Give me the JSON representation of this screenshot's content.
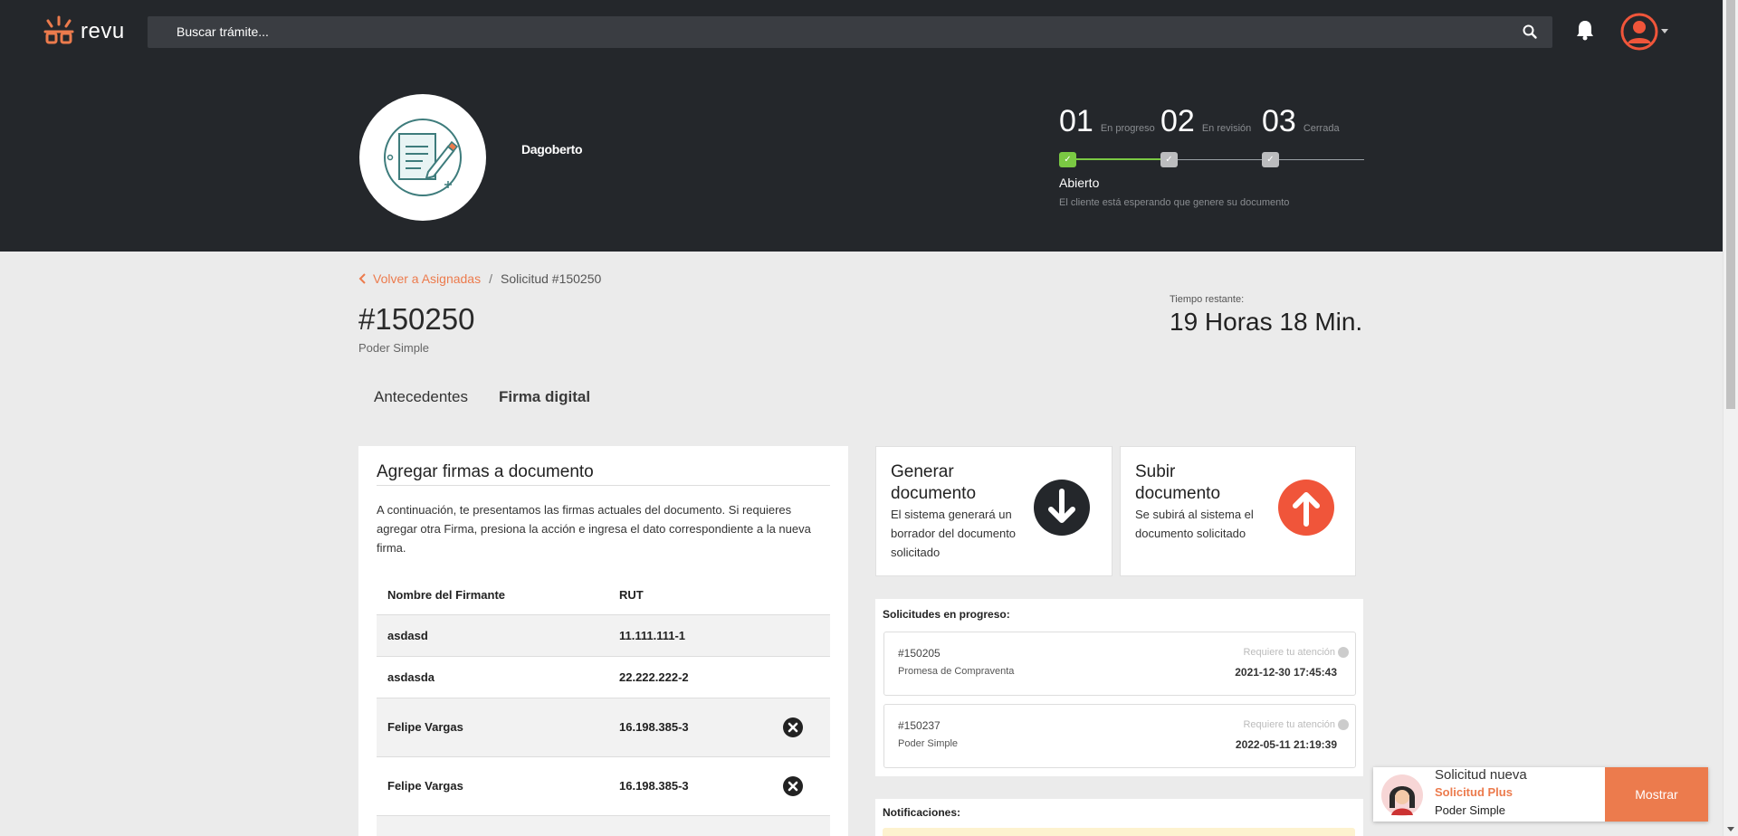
{
  "app": {
    "name": "revu",
    "accent": "#ec7b4d"
  },
  "search": {
    "placeholder": "Buscar trámite..."
  },
  "hero": {
    "client_name": "Dagoberto",
    "steps": [
      {
        "num": "01",
        "label": "En progreso",
        "status": "done"
      },
      {
        "num": "02",
        "label": "En revisión",
        "status": "pending"
      },
      {
        "num": "03",
        "label": "Cerrada",
        "status": "pending"
      }
    ],
    "current_state": "Abierto",
    "current_desc": "El cliente está esperando que genere su documento"
  },
  "breadcrumb": {
    "back": "Volver a Asignadas",
    "current": "Solicitud #150250"
  },
  "request": {
    "id": "#150250",
    "type": "Poder Simple"
  },
  "timer": {
    "label": "Tiempo restante:",
    "value": "19 Horas 18 Min."
  },
  "tabs": [
    {
      "label": "Antecedentes",
      "active": false
    },
    {
      "label": "Firma digital",
      "active": true
    }
  ],
  "signatures_card": {
    "title": "Agregar firmas a documento",
    "description": "A continuación, te presentamos las firmas actuales del documento. Si requieres agregar otra Firma, presiona la acción e ingresa el dato correspondiente a la nueva firma.",
    "columns": [
      "Nombre del Firmante",
      "RUT"
    ],
    "rows": [
      {
        "name": "asdasd",
        "rut": "11.111.111-1",
        "removable": false
      },
      {
        "name": "asdasda",
        "rut": "22.222.222-2",
        "removable": false
      },
      {
        "name": "Felipe Vargas",
        "rut": "16.198.385-3",
        "removable": true
      },
      {
        "name": "Felipe Vargas",
        "rut": "16.198.385-3",
        "removable": true
      }
    ]
  },
  "generate": {
    "title": "Generar documento",
    "text": "El sistema generará un borrador del documento solicitado",
    "color": "#24272b"
  },
  "upload": {
    "title": "Subir documento",
    "text": "Se subirá al sistema el documento solicitado",
    "color": "#f0553a"
  },
  "in_progress": {
    "title": "Solicitudes en progreso:",
    "items": [
      {
        "id": "#150205",
        "type": "Promesa de Compraventa",
        "attention": "Requiere tu atención",
        "date": "2021-12-30 17:45:43"
      },
      {
        "id": "#150237",
        "type": "Poder Simple",
        "attention": "Requiere tu atención",
        "date": "2022-05-11 21:19:39"
      }
    ]
  },
  "notifications": {
    "title": "Notificaciones:"
  },
  "toast": {
    "line1": "Solicitud nueva",
    "line2": "Solicitud Plus",
    "line3": "Poder Simple",
    "button": "Mostrar"
  }
}
